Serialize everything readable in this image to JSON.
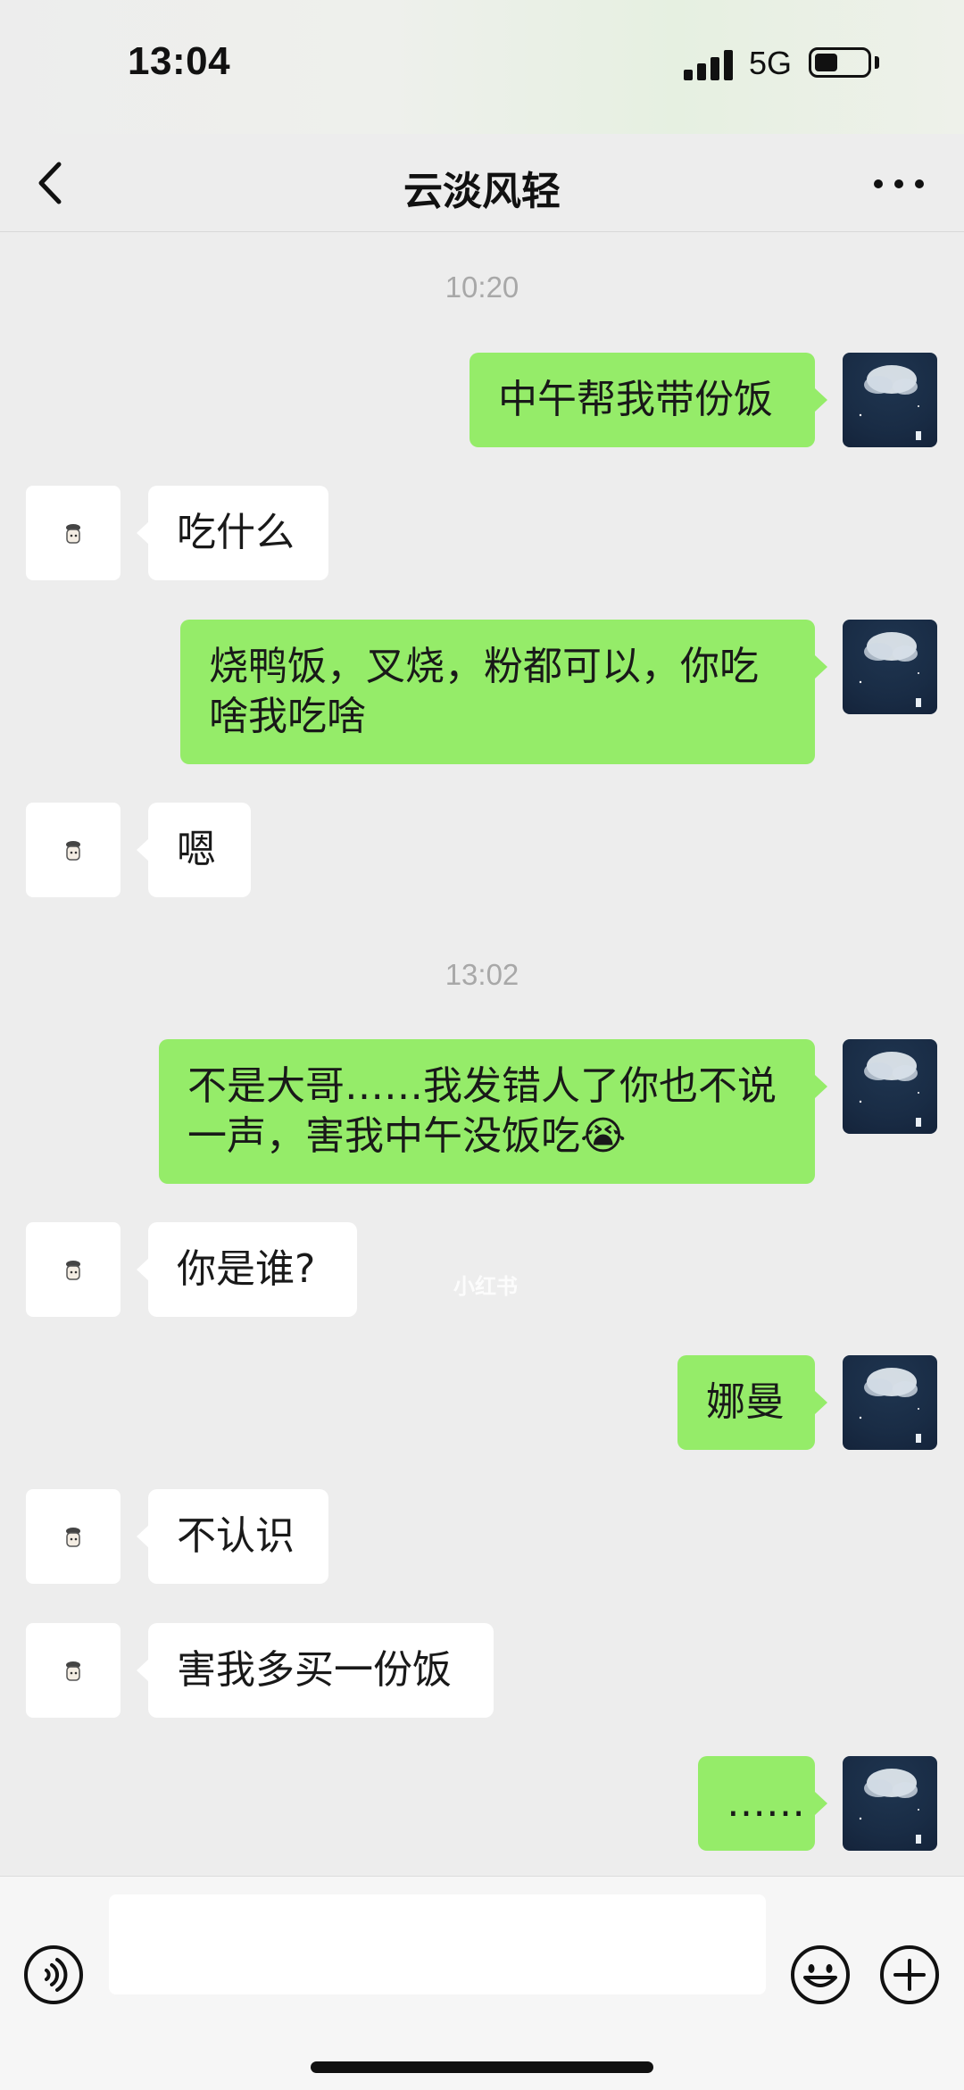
{
  "status_bar": {
    "time": "13:04",
    "network": "5G",
    "battery_level": 0.45,
    "signal_bars": 4
  },
  "nav": {
    "title": "云淡风轻"
  },
  "colors": {
    "chat_background": "#ededed",
    "my_bubble": "#95ec69",
    "other_bubble": "#ffffff"
  },
  "chat": {
    "timestamps": [
      "10:20",
      "13:02"
    ],
    "messages": [
      {
        "from": "me",
        "text": "中午帮我带份饭"
      },
      {
        "from": "other",
        "text": "吃什么"
      },
      {
        "from": "me",
        "text": "烧鸭饭，叉烧，粉都可以，你吃\n啥我吃啥"
      },
      {
        "from": "other",
        "text": "嗯"
      },
      {
        "from": "me",
        "text": "不是大哥……我发错人了你也不说\n一声，害我中午没饭吃😭"
      },
      {
        "from": "other",
        "text": "你是谁?"
      },
      {
        "from": "me",
        "text": "娜曼"
      },
      {
        "from": "other",
        "text": "不认识"
      },
      {
        "from": "other",
        "text": "害我多买一份饭"
      },
      {
        "from": "me",
        "text": "……"
      }
    ],
    "watermark": "小红书"
  },
  "input_bar": {
    "placeholder": "",
    "icons": [
      "voice-icon",
      "emoji-icon",
      "plus-icon"
    ]
  }
}
